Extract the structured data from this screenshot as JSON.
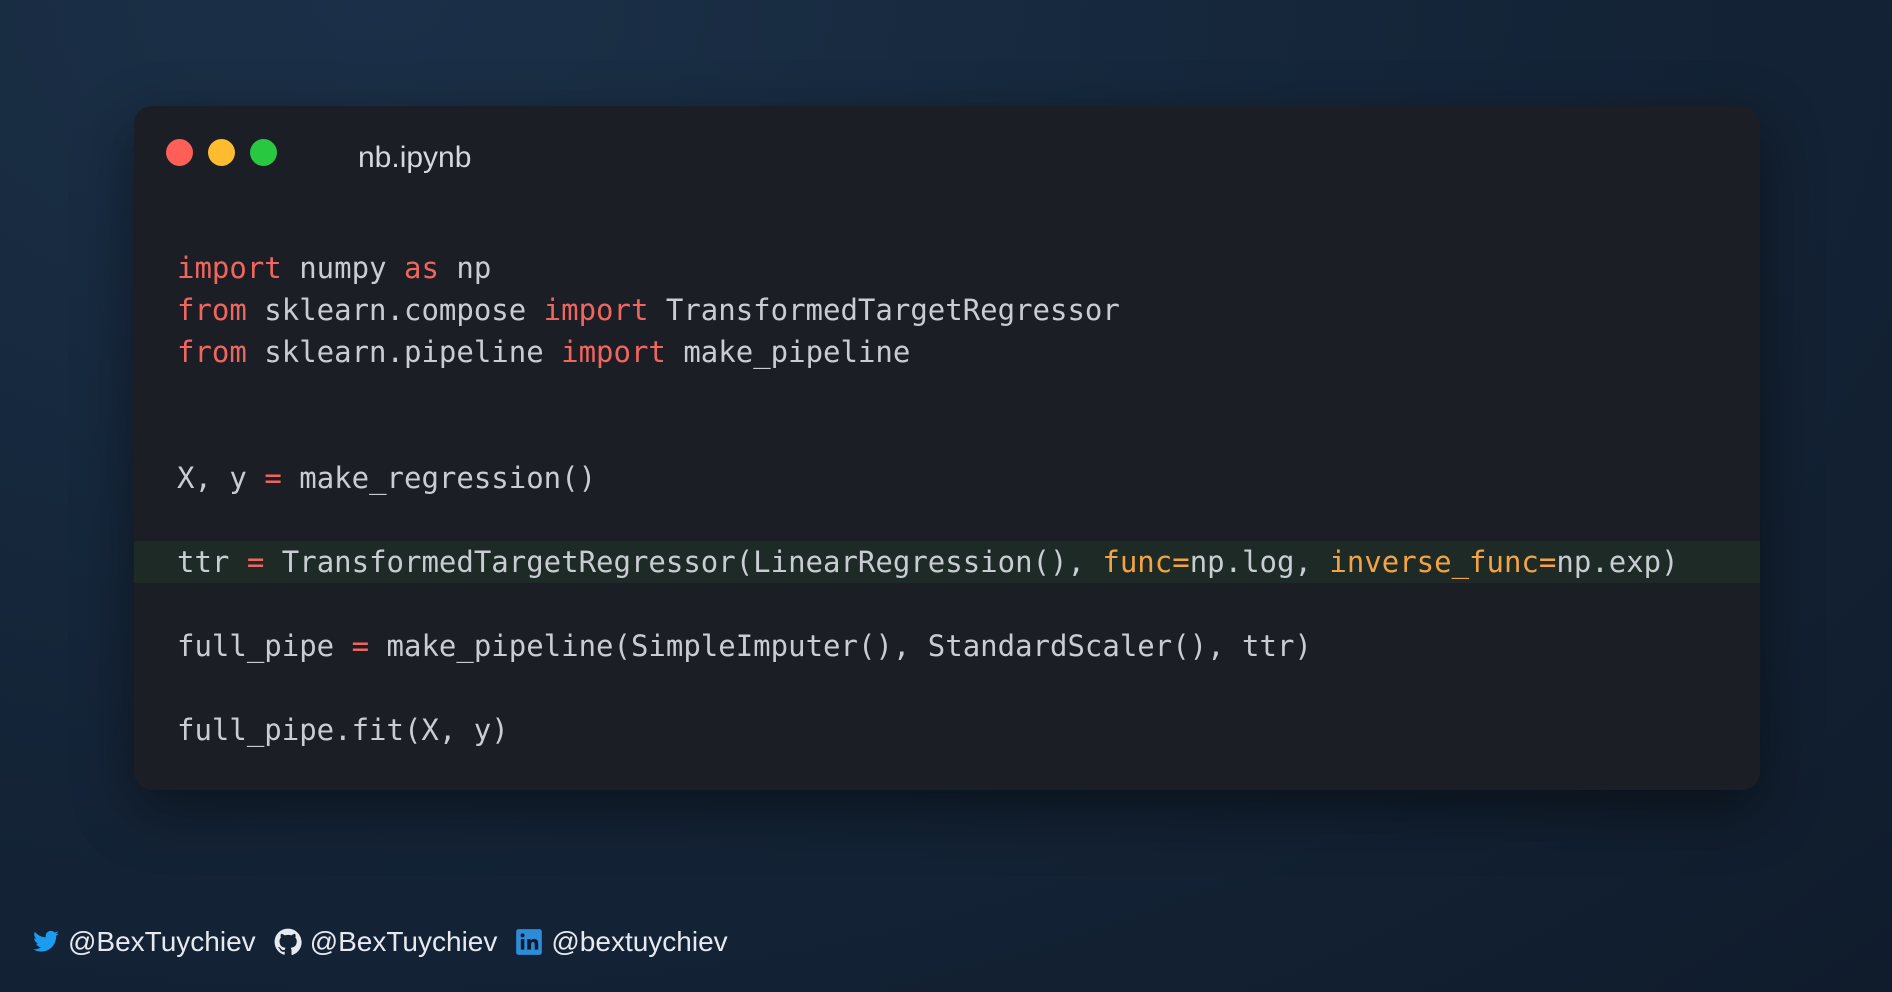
{
  "window": {
    "title": "nb.ipynb"
  },
  "code": {
    "line1": {
      "kw1": "import",
      "t1": " numpy ",
      "kw2": "as",
      "t2": " np"
    },
    "line2": {
      "kw1": "from",
      "t1": " sklearn.compose ",
      "kw2": "import",
      "t2": " TransformedTargetRegressor"
    },
    "line3": {
      "kw1": "from",
      "t1": " sklearn.pipeline ",
      "kw2": "import",
      "t2": " make_pipeline"
    },
    "line4": {
      "t1": "X, y ",
      "op": "=",
      "t2": " make_regression()"
    },
    "line5": {
      "t1": "ttr ",
      "op": "=",
      "t2": " TransformedTargetRegressor(LinearRegression(), ",
      "p1": "func=",
      "t3": "np.log, ",
      "p2": "inverse_func=",
      "t4": "np.exp)"
    },
    "line6": {
      "t1": "full_pipe ",
      "op": "=",
      "t2": " make_pipeline(SimpleImputer(), StandardScaler(), ttr)"
    },
    "line7": {
      "t1": "full_pipe.fit(X, y)"
    }
  },
  "colors": {
    "keyword": "#f0665f",
    "param": "#f2a444",
    "text": "#c9ccd3",
    "highlight_bg": "#1d2a25",
    "twitter": "#1d9bf0",
    "linkedin": "#2e8bd8"
  },
  "footer": {
    "twitter": {
      "icon": "twitter-icon",
      "handle": "@BexTuychiev"
    },
    "github": {
      "icon": "github-icon",
      "handle": "@BexTuychiev"
    },
    "linkedin": {
      "icon": "linkedin-icon",
      "handle": "@bextuychiev"
    }
  }
}
